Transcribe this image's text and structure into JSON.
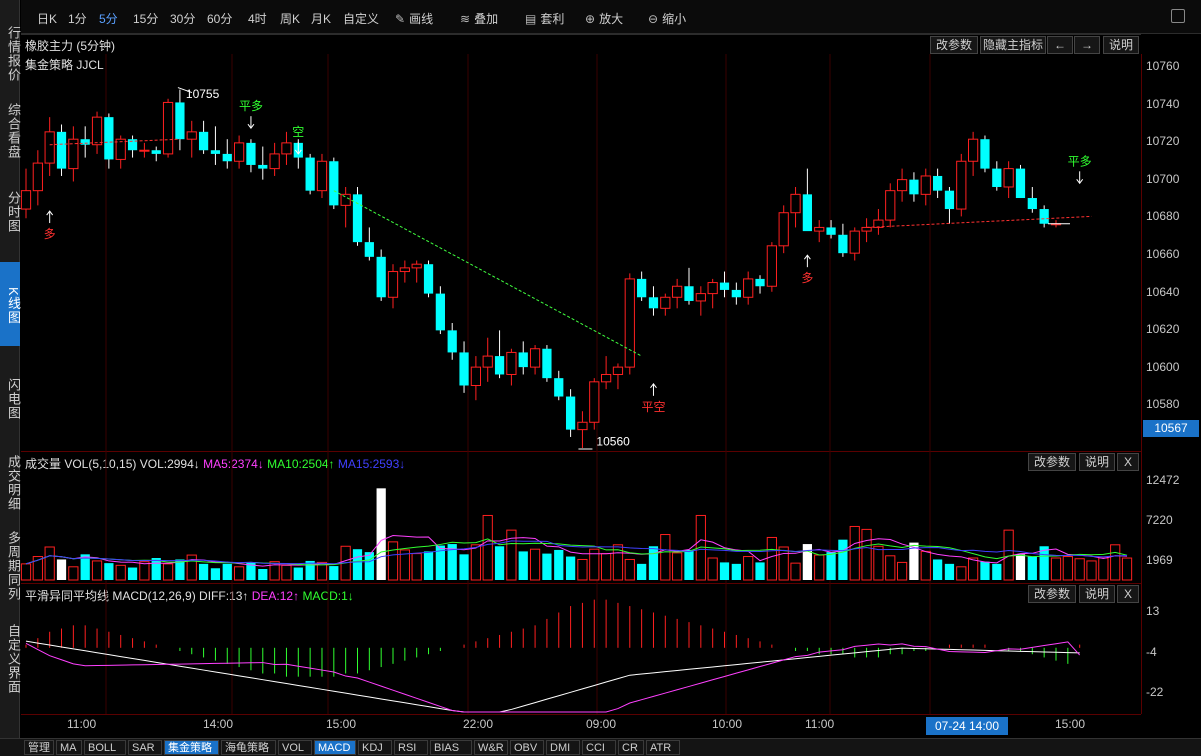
{
  "left_tabs": [
    {
      "label": "行情报价"
    },
    {
      "label": "综合看盘"
    },
    {
      "label": "分时图"
    },
    {
      "label": "K线图"
    },
    {
      "label": "闪电图"
    },
    {
      "label": "成交明细"
    },
    {
      "label": "多周期同列"
    },
    {
      "label": "自定义界面"
    }
  ],
  "toolbar": {
    "periods": [
      "日K",
      "1分",
      "5分",
      "15分",
      "30分",
      "60分",
      "4时",
      "周K",
      "月K",
      "自定义"
    ],
    "active_period": "5分",
    "tools": [
      {
        "label": "画线",
        "icon": "pencil-icon"
      },
      {
        "label": "叠加",
        "icon": "stack-icon"
      },
      {
        "label": "套利",
        "icon": "arbitrage-icon"
      },
      {
        "label": "放大",
        "icon": "zoom-in-icon"
      },
      {
        "label": "缩小",
        "icon": "zoom-out-icon"
      }
    ]
  },
  "main_panel": {
    "title": "橡胶主力 (5分钟)",
    "strategy": "集金策略 JJCL",
    "buttons": [
      "改参数",
      "隐藏主指标",
      "←",
      "→",
      "说明"
    ],
    "y_ticks": [
      "10760",
      "10740",
      "10720",
      "10700",
      "10680",
      "10660",
      "10640",
      "10620",
      "10600",
      "10580"
    ],
    "current_price": "10567",
    "high_label": "10755",
    "low_label": "10560",
    "signals": [
      {
        "text": "多",
        "color": "#ff3030"
      },
      {
        "text": "平多",
        "color": "#30ff30"
      },
      {
        "text": "空",
        "color": "#30ff30"
      },
      {
        "text": "平空",
        "color": "#ff3030"
      },
      {
        "text": "多",
        "color": "#ff3030"
      },
      {
        "text": "平多",
        "color": "#30ff30"
      }
    ]
  },
  "volume_panel": {
    "title": "成交量 VOL(5,10,15)",
    "vol": "VOL:2994↓",
    "ma5": "MA5:2374↓",
    "ma10": "MA10:2504↑",
    "ma15": "MA15:2593↓",
    "buttons": [
      "改参数",
      "说明",
      "X"
    ],
    "y_ticks": [
      "12472",
      "7220",
      "1969"
    ]
  },
  "macd_panel": {
    "title": "平滑异同平均线 MACD(12,26,9)",
    "diff": "DIFF:13↑",
    "dea": "DEA:12↑",
    "macd": "MACD:1↓",
    "buttons": [
      "改参数",
      "说明",
      "X"
    ],
    "y_ticks": [
      "13",
      "-4",
      "-22"
    ]
  },
  "x_axis": {
    "labels": [
      "11:00",
      "14:00",
      "15:00",
      "22:00",
      "09:00",
      "10:00",
      "11:00",
      "15:00"
    ],
    "cursor_label": "07-24 14:00"
  },
  "bottom_tabs": [
    "管理",
    "MA",
    "BOLL",
    "SAR",
    "集金策略",
    "海龟策略",
    "VOL",
    "MACD",
    "KDJ",
    "RSI",
    "BIAS",
    "W&R",
    "OBV",
    "DMI",
    "CCI",
    "CR",
    "ATR"
  ],
  "bottom_active": [
    "集金策略",
    "MACD"
  ],
  "colors": {
    "up": "#ff2020",
    "down": "#00ffff",
    "ma5": "#ff40ff",
    "ma10": "#30ff30",
    "ma15": "#4040ff",
    "accent": "#1a72c8"
  },
  "chart_data": [
    {
      "type": "candlestick",
      "title": "橡胶主力 (5分钟)",
      "ylim": [
        10560,
        10770
      ],
      "ohlc": [
        [
          10690,
          10712,
          10685,
          10700
        ],
        [
          10700,
          10722,
          10692,
          10715
        ],
        [
          10715,
          10740,
          10708,
          10732
        ],
        [
          10732,
          10736,
          10708,
          10712
        ],
        [
          10712,
          10735,
          10705,
          10728
        ],
        [
          10728,
          10735,
          10718,
          10725
        ],
        [
          10725,
          10743,
          10720,
          10740
        ],
        [
          10740,
          10742,
          10712,
          10717
        ],
        [
          10717,
          10730,
          10712,
          10728
        ],
        [
          10728,
          10730,
          10718,
          10722
        ],
        [
          10722,
          10726,
          10718,
          10722
        ],
        [
          10722,
          10724,
          10716,
          10720
        ],
        [
          10720,
          10750,
          10718,
          10748
        ],
        [
          10748,
          10755,
          10722,
          10728
        ],
        [
          10728,
          10738,
          10718,
          10732
        ],
        [
          10732,
          10738,
          10720,
          10722
        ],
        [
          10722,
          10735,
          10714,
          10720
        ],
        [
          10720,
          10728,
          10712,
          10716
        ],
        [
          10716,
          10730,
          10712,
          10726
        ],
        [
          10726,
          10728,
          10710,
          10714
        ],
        [
          10714,
          10724,
          10706,
          10712
        ],
        [
          10712,
          10726,
          10708,
          10720
        ],
        [
          10720,
          10732,
          10714,
          10726
        ],
        [
          10726,
          10728,
          10712,
          10718
        ],
        [
          10718,
          10720,
          10698,
          10700
        ],
        [
          10700,
          10720,
          10696,
          10716
        ],
        [
          10716,
          10718,
          10690,
          10692
        ],
        [
          10692,
          10702,
          10680,
          10698
        ],
        [
          10698,
          10702,
          10670,
          10672
        ],
        [
          10672,
          10680,
          10662,
          10664
        ],
        [
          10664,
          10668,
          10640,
          10642
        ],
        [
          10642,
          10660,
          10636,
          10656
        ],
        [
          10656,
          10662,
          10650,
          10658
        ],
        [
          10658,
          10662,
          10650,
          10660
        ],
        [
          10660,
          10662,
          10642,
          10644
        ],
        [
          10644,
          10648,
          10622,
          10624
        ],
        [
          10624,
          10628,
          10608,
          10612
        ],
        [
          10612,
          10618,
          10590,
          10594
        ],
        [
          10594,
          10610,
          10586,
          10604
        ],
        [
          10604,
          10620,
          10596,
          10610
        ],
        [
          10610,
          10624,
          10598,
          10600
        ],
        [
          10600,
          10614,
          10594,
          10612
        ],
        [
          10612,
          10618,
          10600,
          10604
        ],
        [
          10604,
          10616,
          10600,
          10614
        ],
        [
          10614,
          10616,
          10596,
          10598
        ],
        [
          10598,
          10602,
          10586,
          10588
        ],
        [
          10588,
          10592,
          10566,
          10570
        ],
        [
          10570,
          10580,
          10560,
          10574
        ],
        [
          10574,
          10598,
          10570,
          10596
        ],
        [
          10596,
          10610,
          10592,
          10600
        ],
        [
          10600,
          10606,
          10592,
          10604
        ],
        [
          10604,
          10655,
          10600,
          10652
        ],
        [
          10652,
          10656,
          10640,
          10642
        ],
        [
          10642,
          10648,
          10632,
          10636
        ],
        [
          10636,
          10644,
          10632,
          10642
        ],
        [
          10642,
          10652,
          10636,
          10648
        ],
        [
          10648,
          10658,
          10638,
          10640
        ],
        [
          10640,
          10648,
          10632,
          10644
        ],
        [
          10644,
          10652,
          10636,
          10650
        ],
        [
          10650,
          10656,
          10642,
          10646
        ],
        [
          10646,
          10650,
          10638,
          10642
        ],
        [
          10642,
          10656,
          10638,
          10652
        ],
        [
          10652,
          10654,
          10644,
          10648
        ],
        [
          10648,
          10672,
          10645,
          10670
        ],
        [
          10670,
          10692,
          10666,
          10688
        ],
        [
          10688,
          10702,
          10680,
          10698
        ],
        [
          10698,
          10712,
          10692,
          10678
        ],
        [
          10678,
          10684,
          10672,
          10680
        ],
        [
          10680,
          10684,
          10674,
          10676
        ],
        [
          10676,
          10682,
          10664,
          10666
        ],
        [
          10666,
          10680,
          10662,
          10678
        ],
        [
          10678,
          10685,
          10672,
          10680
        ],
        [
          10680,
          10690,
          10676,
          10684
        ],
        [
          10684,
          10704,
          10680,
          10700
        ],
        [
          10700,
          10712,
          10694,
          10706
        ],
        [
          10706,
          10710,
          10694,
          10698
        ],
        [
          10698,
          10712,
          10692,
          10708
        ],
        [
          10708,
          10712,
          10696,
          10700
        ],
        [
          10700,
          10702,
          10682,
          10690
        ],
        [
          10690,
          10720,
          10686,
          10716
        ],
        [
          10716,
          10732,
          10708,
          10728
        ],
        [
          10728,
          10730,
          10710,
          10712
        ],
        [
          10712,
          10716,
          10700,
          10702
        ],
        [
          10702,
          10716,
          10696,
          10712
        ],
        [
          10712,
          10714,
          10700,
          10696
        ],
        [
          10696,
          10702,
          10688,
          10690
        ],
        [
          10690,
          10692,
          10680,
          10682
        ],
        [
          10682,
          10684,
          10680,
          10682
        ]
      ]
    },
    {
      "type": "bar",
      "title": "成交量 VOL(5,10,15)",
      "ylim": [
        0,
        15000
      ],
      "values": [
        2200,
        3200,
        4500,
        2800,
        1800,
        3500,
        2600,
        2300,
        2000,
        1700,
        2500,
        3000,
        2200,
        2800,
        3400,
        2200,
        1600,
        2200,
        1800,
        2400,
        1500,
        2500,
        2000,
        1700,
        2600,
        2400,
        1900,
        4600,
        4200,
        3800,
        12500,
        5200,
        4100,
        3600,
        3900,
        4700,
        4900,
        3500,
        4800,
        8800,
        4600,
        6800,
        3900,
        4200,
        3600,
        4100,
        3200,
        2800,
        4200,
        3600,
        4800,
        2800,
        2200,
        4600,
        6200,
        3700,
        4100,
        8800,
        3000,
        2400,
        2200,
        3200,
        2400,
        5800,
        4500,
        2300,
        4900,
        3400,
        3800,
        5500,
        7300,
        6900,
        4600,
        3300,
        2400,
        5100,
        3900,
        2800,
        2200,
        1800,
        3000,
        2500,
        2200,
        6800,
        3500,
        3200,
        4600,
        3000,
        3200,
        2900,
        2600,
        3000,
        4800,
        2994
      ]
    },
    {
      "type": "bar",
      "title": "平滑异同平均线 MACD(12,26,9)",
      "ylim": [
        -30,
        20
      ],
      "values": [
        1,
        3,
        5,
        6,
        7,
        7,
        6,
        5,
        4,
        3,
        2,
        1,
        0,
        -1,
        -2,
        -3,
        -4,
        -5,
        -6,
        -7,
        -8,
        -8,
        -9,
        -9,
        -9,
        -9,
        -9,
        -8,
        -8,
        -7,
        -6,
        -5,
        -4,
        -3,
        -2,
        -1,
        0,
        1,
        2,
        3,
        4,
        5,
        6,
        7,
        9,
        11,
        13,
        14,
        15,
        15,
        14,
        13,
        12,
        11,
        10,
        9,
        8,
        7,
        6,
        5,
        4,
        3,
        2,
        1,
        0,
        -1,
        -1,
        -2,
        -2,
        -2,
        -3,
        -3,
        -3,
        -2,
        -2,
        -1,
        -1,
        0,
        1,
        1,
        1,
        1,
        0,
        -1,
        -1,
        -2,
        -3,
        -4,
        -5,
        1
      ]
    }
  ]
}
